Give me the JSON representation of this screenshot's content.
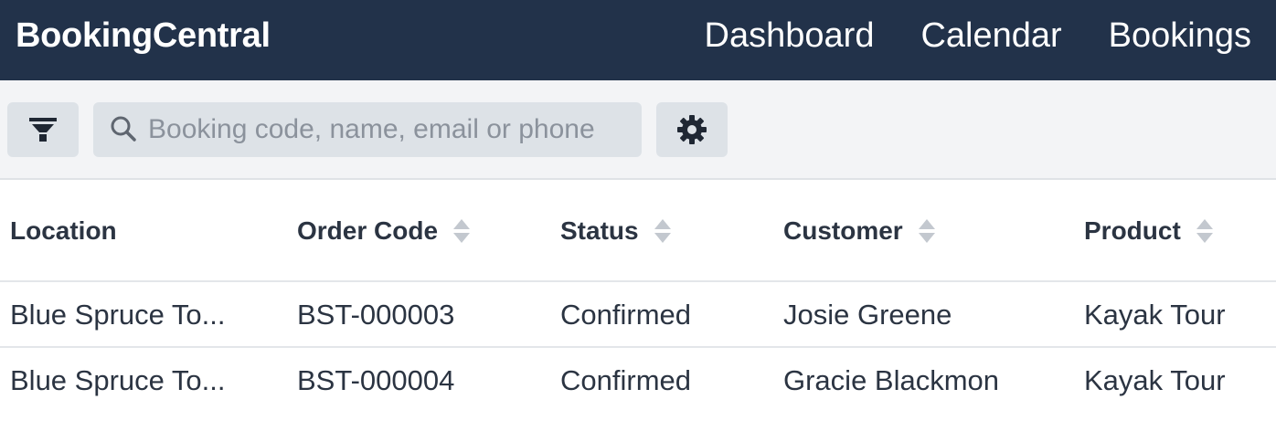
{
  "app": {
    "brand": "BookingCentral"
  },
  "nav": {
    "items": [
      {
        "label": "Dashboard"
      },
      {
        "label": "Calendar"
      },
      {
        "label": "Bookings"
      }
    ]
  },
  "toolbar": {
    "filter_icon": "filter-icon",
    "search_icon": "search-icon",
    "settings_icon": "gear-icon",
    "search": {
      "value": "",
      "placeholder": "Booking code, name, email or phone"
    }
  },
  "table": {
    "columns": [
      {
        "label": "Location",
        "sortable": false
      },
      {
        "label": "Order Code",
        "sortable": true
      },
      {
        "label": "Status",
        "sortable": true
      },
      {
        "label": "Customer",
        "sortable": true
      },
      {
        "label": "Product",
        "sortable": true
      }
    ],
    "rows": [
      {
        "location": "Blue Spruce To...",
        "order_code": "BST-000003",
        "status": "Confirmed",
        "customer": "Josie Greene",
        "product": "Kayak Tour"
      },
      {
        "location": "Blue Spruce To...",
        "order_code": "BST-000004",
        "status": "Confirmed",
        "customer": "Gracie Blackmon",
        "product": "Kayak Tour"
      }
    ]
  },
  "colors": {
    "topbar": "#22324a",
    "toolbar": "#f3f4f6",
    "button": "#dde2e7",
    "text": "#2b3442"
  }
}
